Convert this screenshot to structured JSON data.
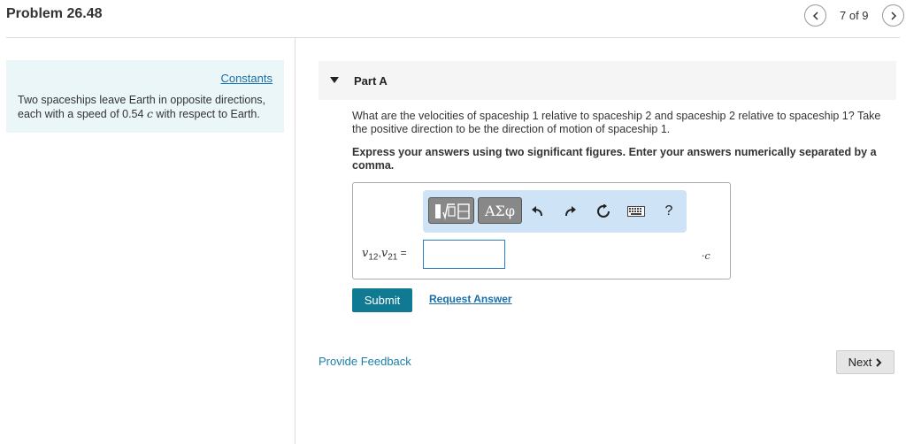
{
  "header": {
    "problem_title": "Problem 26.48",
    "page_count": "7 of 9"
  },
  "sidebar": {
    "constants_link": "Constants",
    "problem_text_before": "Two spaceships leave Earth in opposite directions, each with a speed of 0.54 ",
    "problem_text_symbol": "c",
    "problem_text_after": " with respect to Earth."
  },
  "part": {
    "label": "Part A",
    "question": "What are the velocities of spaceship 1 relative to spaceship 2 and spaceship 2 relative to spaceship 1? Take the positive direction to be the direction of motion of spaceship 1.",
    "instruction": "Express your answers using two significant figures. Enter your answers numerically separated by a comma."
  },
  "answer": {
    "greek_button": "ΑΣφ",
    "help_button": "?",
    "var_v": "v",
    "sub_12": "12",
    "sep": ",",
    "sub_21": "21",
    "equals": "=",
    "input_value": "",
    "unit": "·c"
  },
  "actions": {
    "submit": "Submit",
    "request_answer": "Request Answer",
    "provide_feedback": "Provide Feedback",
    "next": "Next"
  },
  "colors": {
    "accent": "#0f7a91",
    "link": "#1a6fa8",
    "constants_bg": "#eaf6f8",
    "toolbar_bg": "#cfe3f7"
  }
}
